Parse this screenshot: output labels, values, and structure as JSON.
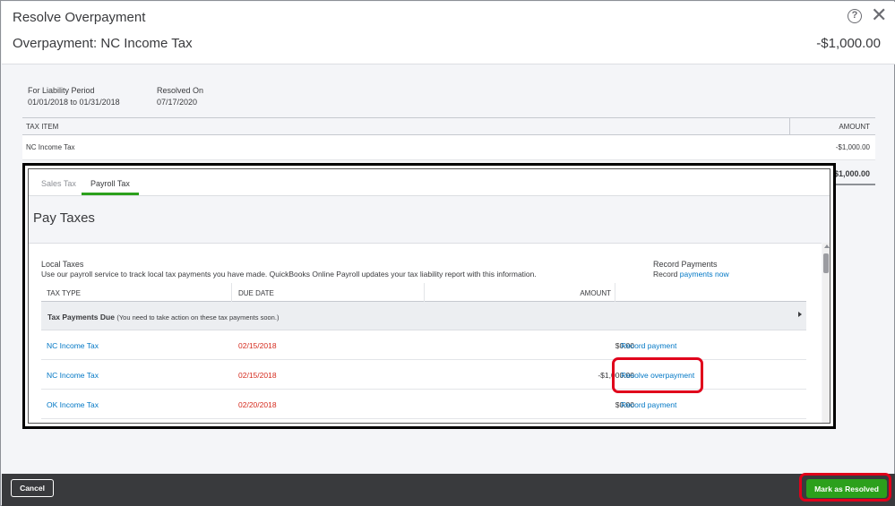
{
  "dialog": {
    "title": "Resolve Overpayment",
    "overpayment_title": "Overpayment: NC Income Tax",
    "overpayment_amount": "-$1,000.00",
    "help_glyph": "?",
    "close_glyph": "✕"
  },
  "meta": {
    "period_label": "For Liability Period",
    "period_value": "01/01/2018 to 01/31/2018",
    "resolved_label": "Resolved On",
    "resolved_value": "07/17/2020"
  },
  "summary_table": {
    "headers": {
      "tax_item": "TAX ITEM",
      "amount": "AMOUNT"
    },
    "rows": [
      {
        "tax_item": "NC Income Tax",
        "amount": "-$1,000.00"
      }
    ],
    "total": "-$1,000.00"
  },
  "embedded": {
    "tabs": [
      {
        "label": "Sales Tax"
      },
      {
        "label": "Payroll Tax"
      }
    ],
    "active_tab": "Payroll Tax",
    "page_title": "Pay Taxes",
    "local_taxes_title": "Local Taxes",
    "local_taxes_desc": "Use our payroll service to track local tax payments you have made. QuickBooks Online Payroll updates your tax liability report with this information.",
    "record_payments_title": "Record Payments",
    "record_prefix": "Record",
    "record_link": "payments now",
    "columns": {
      "tax_type": "TAX TYPE",
      "due_date": "DUE DATE",
      "amount": "AMOUNT"
    },
    "group": {
      "title": "Tax Payments Due",
      "note": "(You need to take action on these tax payments soon.)"
    },
    "rows": [
      {
        "tax_type": "NC Income Tax",
        "due_date": "02/15/2018",
        "amount": "$0.00",
        "action": "Record payment"
      },
      {
        "tax_type": "NC Income Tax",
        "due_date": "02/15/2018",
        "amount": "-$1,000.00",
        "action": "Resolve overpayment"
      },
      {
        "tax_type": "OK Income Tax",
        "due_date": "02/20/2018",
        "amount": "$0.00",
        "action": "Record payment"
      }
    ]
  },
  "footer": {
    "cancel_label": "Cancel",
    "mark_resolved_label": "Mark as Resolved"
  },
  "colors": {
    "accent_green": "#2ca01c",
    "link_blue": "#0077c5",
    "due_red": "#d52b1e",
    "highlight_red": "#e0001b",
    "footer_bg": "#393a3d"
  }
}
